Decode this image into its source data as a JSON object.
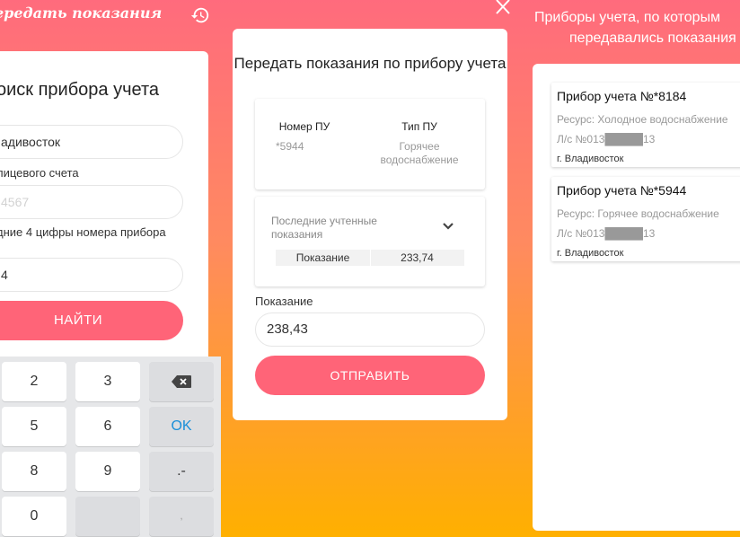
{
  "search_screen": {
    "title": "ередать показания",
    "heading": "оиск прибора учета",
    "city_value": "адивосток",
    "account_label": "лицевого счета",
    "account_placeholder": "4567",
    "digits_label": "дние 4 цифры номера прибора",
    "digits_value": "4",
    "find_button": "НАЙТИ",
    "keyboard": {
      "keys": [
        "2",
        "3",
        "5",
        "6",
        "OK",
        "8",
        "9",
        ".-",
        "0",
        ","
      ]
    }
  },
  "submit_screen": {
    "heading": "Передать показания по прибору учета",
    "device_number_label": "Номер ПУ",
    "device_number_value": "*5944",
    "device_type_label": "Тип ПУ",
    "device_type_value": "Горячее водоснабжение",
    "last_readings_title": "Последние учтенные показания",
    "last_reading_label": "Показание",
    "last_reading_value": "233,74",
    "reading_label": "Показание",
    "reading_value": "238,43",
    "send_button": "ОТПРАВИТЬ"
  },
  "history_screen": {
    "header_line1": "Приборы учета, по которым",
    "header_line2": "передавались показания",
    "devices": [
      {
        "title": "Прибор учета №*8184",
        "resource": "Ресурс: Холодное водоснабжение",
        "account": "Л/с №013█████13",
        "city": "г. Владивосток"
      },
      {
        "title": "Прибор учета №*5944",
        "resource": "Ресурс: Горячее водоснабжение",
        "account": "Л/с №013█████13",
        "city": "г. Владивосток"
      }
    ]
  },
  "colors": {
    "accent": "#ff6478",
    "gradient_top": "#ff6b7d",
    "gradient_bottom": "#ffb000",
    "ok_key": "#1a8fd8"
  },
  "icons": [
    "history-icon",
    "close-icon",
    "backspace-icon",
    "chevron-down-icon"
  ]
}
